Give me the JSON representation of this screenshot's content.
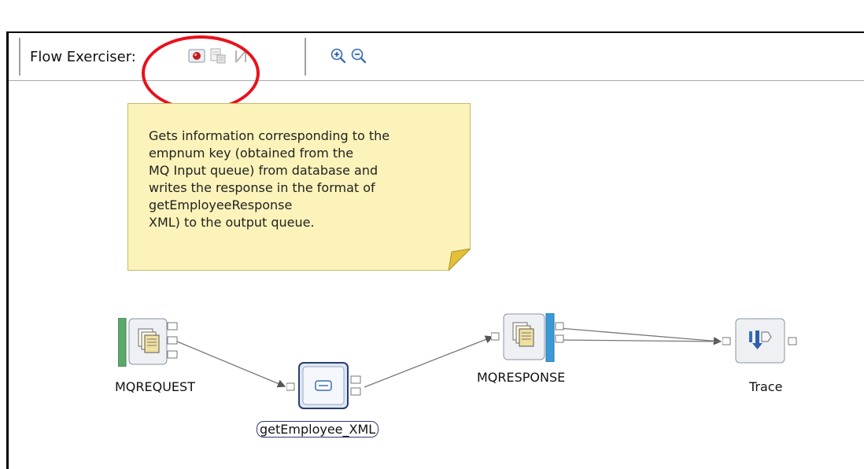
{
  "toolbar": {
    "label": "Flow Exerciser:",
    "buttons": [
      {
        "name": "record-icon",
        "tooltip": ""
      },
      {
        "name": "view-message-icon",
        "tooltip": ""
      },
      {
        "name": "path-icon",
        "tooltip": ""
      },
      {
        "name": "zoom-in-icon",
        "tooltip": ""
      },
      {
        "name": "zoom-out-icon",
        "tooltip": ""
      }
    ]
  },
  "note": {
    "text": "Gets information corresponding to the\nempnum key (obtained from the\nMQ Input queue) from database and\nwrites the response in the format of\ngetEmployeeResponse\nXML) to the output queue."
  },
  "nodes": {
    "mqrequest": {
      "label": "MQREQUEST",
      "icon": "mq-input-icon"
    },
    "getemployee": {
      "label": "getEmployee_XML",
      "icon": "mapping-icon"
    },
    "mqresponse": {
      "label": "MQRESPONSE",
      "icon": "mq-output-icon"
    },
    "trace": {
      "label": "Trace",
      "icon": "trace-icon"
    }
  },
  "colors": {
    "highlight": "#e8121c",
    "note_bg": "#fbf3b9",
    "input_bar": "#5aa86a",
    "output_bar": "#3a9ad9"
  }
}
